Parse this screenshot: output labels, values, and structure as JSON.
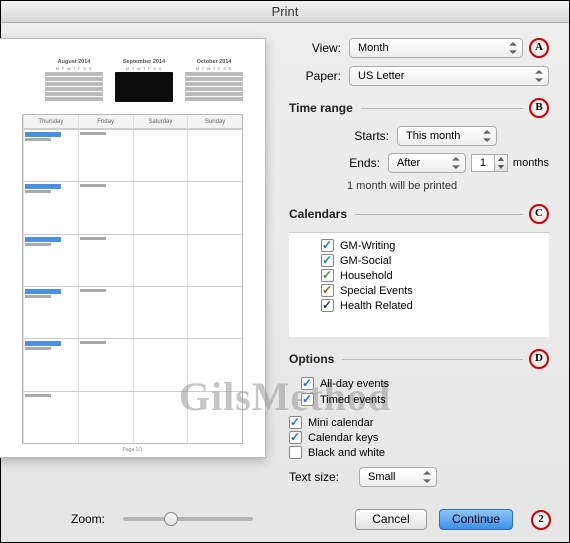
{
  "window": {
    "title": "Print"
  },
  "preview": {
    "months": [
      "August 2014",
      "September 2014",
      "October 2014"
    ],
    "weekdays": [
      "Thursday",
      "Friday",
      "Saturday",
      "Sunday"
    ],
    "page_label": "Page 1/1"
  },
  "zoom": {
    "label": "Zoom:",
    "value": 35
  },
  "view": {
    "label": "View:",
    "value": "Month"
  },
  "paper": {
    "label": "Paper:",
    "value": "US Letter"
  },
  "badges": {
    "a": "A",
    "b": "B",
    "c": "C",
    "d": "D",
    "step2": "2"
  },
  "time_range": {
    "title": "Time range",
    "starts_label": "Starts:",
    "starts_value": "This month",
    "ends_label": "Ends:",
    "ends_value": "After",
    "count": "1",
    "unit": "months",
    "summary": "1 month will be printed"
  },
  "calendars": {
    "title": "Calendars",
    "items": [
      {
        "label": "GM-Writing",
        "checked": true,
        "color": "blue"
      },
      {
        "label": "GM-Social",
        "checked": true,
        "color": "teal"
      },
      {
        "label": "Household",
        "checked": true,
        "color": "green"
      },
      {
        "label": "Special Events",
        "checked": true,
        "color": "brown"
      },
      {
        "label": "Health Related",
        "checked": true,
        "color": "dark"
      }
    ]
  },
  "options": {
    "title": "Options",
    "allday": {
      "label": "All-day events",
      "checked": true
    },
    "timed": {
      "label": "Timed events",
      "checked": true
    },
    "mini": {
      "label": "Mini calendar",
      "checked": true
    },
    "keys": {
      "label": "Calendar keys",
      "checked": true
    },
    "bw": {
      "label": "Black and white",
      "checked": false
    }
  },
  "textsize": {
    "label": "Text size:",
    "value": "Small"
  },
  "buttons": {
    "cancel": "Cancel",
    "continue": "Continue"
  },
  "watermark": "GilsMethod"
}
